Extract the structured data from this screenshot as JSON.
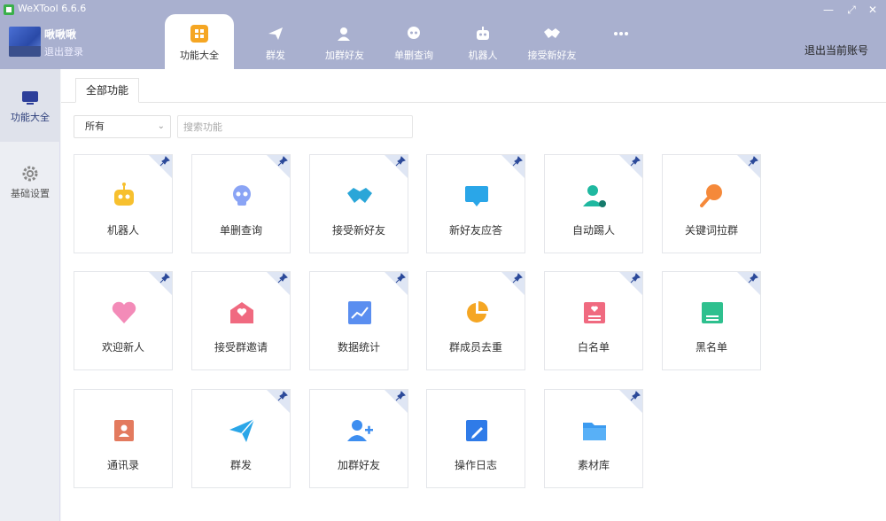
{
  "app": {
    "title": "WeXTool 6.6.6"
  },
  "window": {
    "minimize": "—",
    "maximize": "⤢",
    "close": "✕"
  },
  "user": {
    "name": "啾啾啾",
    "logout": "退出登录"
  },
  "top_tabs": [
    {
      "label": "功能大全",
      "icon": "grid-icon"
    },
    {
      "label": "群发",
      "icon": "send-icon"
    },
    {
      "label": "加群好友",
      "icon": "add-user-icon"
    },
    {
      "label": "单删查询",
      "icon": "skull-icon"
    },
    {
      "label": "机器人",
      "icon": "robot-icon"
    },
    {
      "label": "接受新好友",
      "icon": "handshake-icon"
    },
    {
      "label": "",
      "icon": "more-icon"
    }
  ],
  "logout_account": "退出当前账号",
  "sidebar": {
    "items": [
      {
        "label": "功能大全",
        "icon": "monitor-icon"
      },
      {
        "label": "基础设置",
        "icon": "gear-icon"
      }
    ]
  },
  "main": {
    "tab_label": "全部功能",
    "filter_value": "所有",
    "search_placeholder": "搜索功能"
  },
  "features": [
    {
      "label": "机器人",
      "icon": "robot-icon"
    },
    {
      "label": "单删查询",
      "icon": "skull-icon"
    },
    {
      "label": "接受新好友",
      "icon": "handshake-icon"
    },
    {
      "label": "新好友应答",
      "icon": "chat-icon"
    },
    {
      "label": "自动踢人",
      "icon": "kick-user-icon"
    },
    {
      "label": "关键词拉群",
      "icon": "magnifier-icon"
    },
    {
      "label": "欢迎新人",
      "icon": "heart-icon"
    },
    {
      "label": "接受群邀请",
      "icon": "mail-heart-icon"
    },
    {
      "label": "数据统计",
      "icon": "chart-icon"
    },
    {
      "label": "群成员去重",
      "icon": "pie-icon"
    },
    {
      "label": "白名单",
      "icon": "whitelist-icon"
    },
    {
      "label": "黑名单",
      "icon": "blacklist-icon"
    },
    {
      "label": "通讯录",
      "icon": "contacts-icon"
    },
    {
      "label": "群发",
      "icon": "send-icon"
    },
    {
      "label": "加群好友",
      "icon": "add-user-icon"
    },
    {
      "label": "操作日志",
      "icon": "log-icon"
    },
    {
      "label": "素材库",
      "icon": "folder-icon"
    }
  ],
  "colors": {
    "header": "#a9b0cf",
    "sidebar_active": "#dfe2eb",
    "pin": "#2c4a9a",
    "corner": "#dfe6f4"
  }
}
